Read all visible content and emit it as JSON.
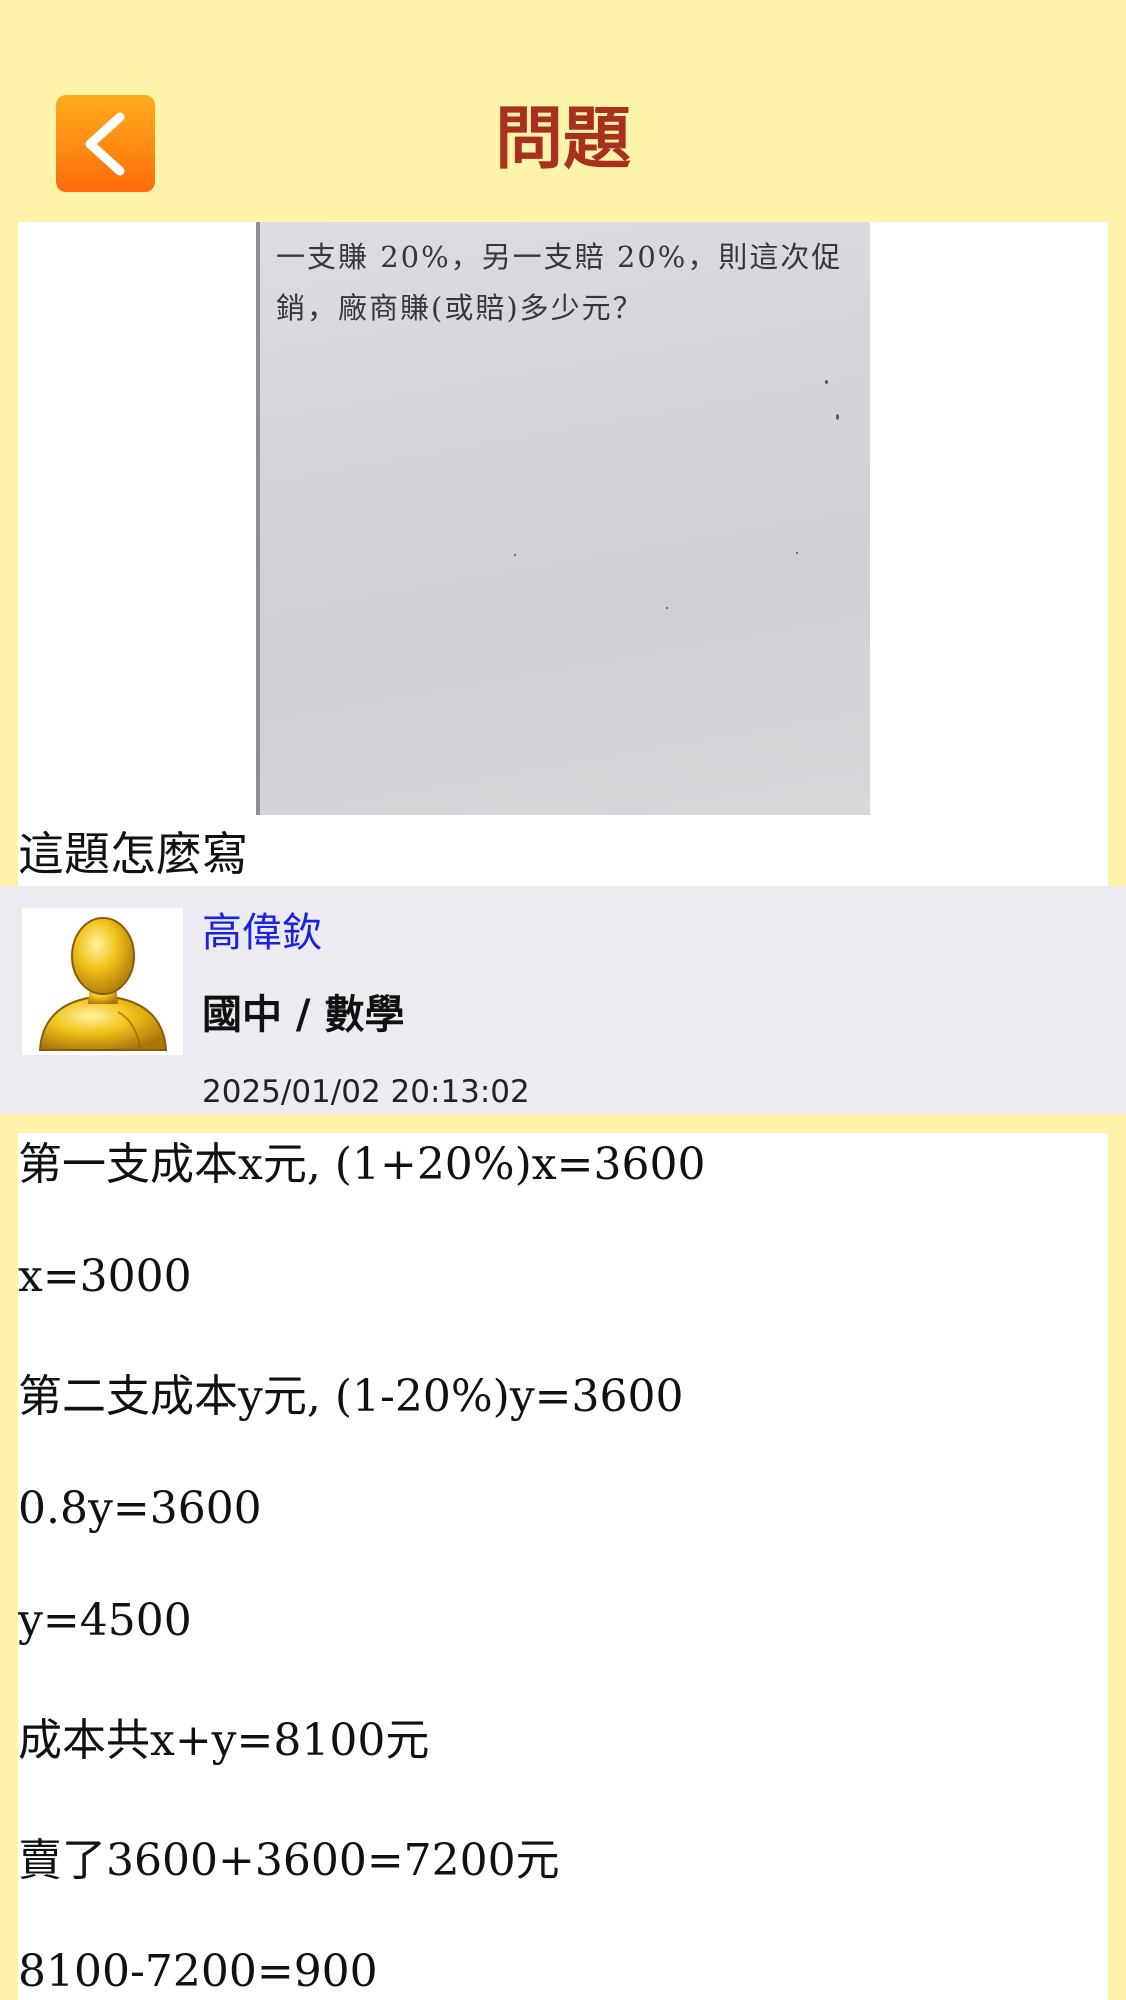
{
  "header": {
    "title": "問題",
    "back_icon": "chevron-left-icon",
    "accent": "#ff7a10",
    "title_color": "#a8301e",
    "background": "#fdf3a9"
  },
  "question": {
    "image_text": [
      "一支賺 20%，另一支賠 20%，則這次促",
      "銷，廠商賺(或賠)多少元？"
    ],
    "text": "這題怎麼寫"
  },
  "answer": {
    "author_name": "高偉欽",
    "subject": "國中 / 數學",
    "timestamp": "2025/01/02 20:13:02",
    "name_color": "#1722e3",
    "lines": [
      "第一支成本x元, (1+20%)x=3600",
      "x=3000",
      "第二支成本y元, (1-20%)y=3600",
      "0.8y=3600",
      "y=4500",
      "成本共x+y=8100元",
      "賣了3600+3600=7200元",
      "8100-7200=900"
    ]
  }
}
